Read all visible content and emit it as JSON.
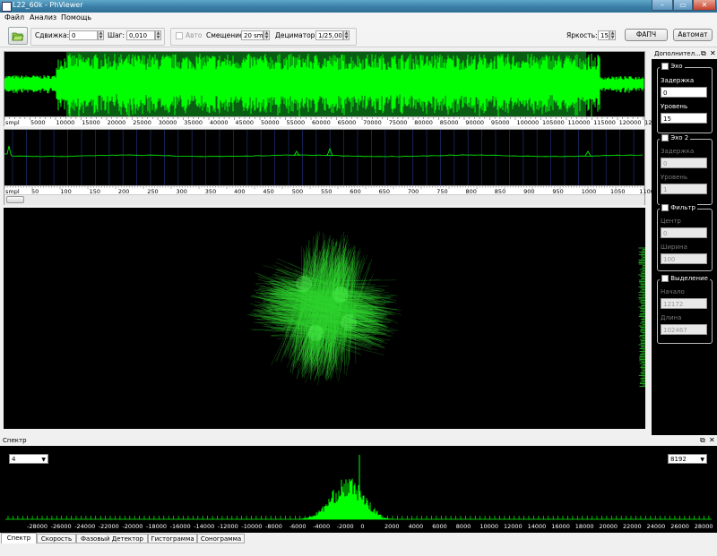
{
  "window": {
    "title": "L22_60k - PhViewer",
    "minimize": "–",
    "maximize": "▭",
    "close": "✕"
  },
  "menu": [
    "Файл",
    "Анализ",
    "Помощь"
  ],
  "toolbar": {
    "shift_label": "Сдвижка:",
    "shift_value": "0",
    "step_label": "Шаг:",
    "step_value": "0,010",
    "auto_label": "Авто",
    "offset_label": "Смещение:",
    "offset_value": "20 smpl",
    "decimator_label": "Дециматор:",
    "decimator_value": "1/25,00",
    "brightness_label": "Яркость:",
    "brightness_value": "15",
    "fapch_button": "ФАПЧ",
    "automat_button": "Автомат"
  },
  "wave": {
    "unit": "smpl",
    "ticks": [
      "5000",
      "10000",
      "15000",
      "20000",
      "25000",
      "30000",
      "35000",
      "40000",
      "45000",
      "50000",
      "55000",
      "60000",
      "65000",
      "70000",
      "75000",
      "80000",
      "85000",
      "90000",
      "95000",
      "100000",
      "105000",
      "110000",
      "115000",
      "120000",
      "12"
    ],
    "color": "#00ff00",
    "selection_color": "#0a5e14"
  },
  "zoom": {
    "unit": "smpl",
    "ticks": [
      "50",
      "100",
      "150",
      "200",
      "250",
      "300",
      "350",
      "400",
      "450",
      "500",
      "550",
      "600",
      "650",
      "700",
      "750",
      "800",
      "850",
      "900",
      "950",
      "1000",
      "1050",
      "1100"
    ]
  },
  "side": {
    "title": "Дополнител...",
    "float_icon": "float-icon",
    "close_icon": "close-icon",
    "echo": {
      "label": "Эхо",
      "checked": "✓",
      "delay_label": "Задержка",
      "delay_value": "0",
      "level_label": "Уровень",
      "level_value": "15"
    },
    "echo2": {
      "label": "Эхо 2",
      "delay_label": "Задержка",
      "delay_value": "0",
      "level_label": "Уровень",
      "level_value": "1"
    },
    "filter": {
      "label": "Фильтр",
      "center_label": "Центр",
      "center_value": "0",
      "width_label": "Ширина",
      "width_value": "100"
    },
    "selection": {
      "label": "Выделение",
      "start_label": "Начало",
      "start_value": "12172",
      "length_label": "Длина",
      "length_value": "102467"
    }
  },
  "spectrum": {
    "title": "Спектр",
    "left_select": "4",
    "right_select": "8192",
    "ticks": [
      "-28000",
      "-26000",
      "-24000",
      "-22000",
      "-20000",
      "-18000",
      "-16000",
      "-14000",
      "-12000",
      "-10000",
      "-8000",
      "-6000",
      "-4000",
      "-2000",
      "0",
      "2000",
      "4000",
      "6000",
      "8000",
      "10000",
      "12000",
      "14000",
      "16000",
      "18000",
      "20000",
      "22000",
      "24000",
      "26000",
      "28000"
    ]
  },
  "tabs": [
    "Спектр",
    "Скорость",
    "Фазовый Детектор",
    "Гистограмма",
    "Сонограмма"
  ]
}
